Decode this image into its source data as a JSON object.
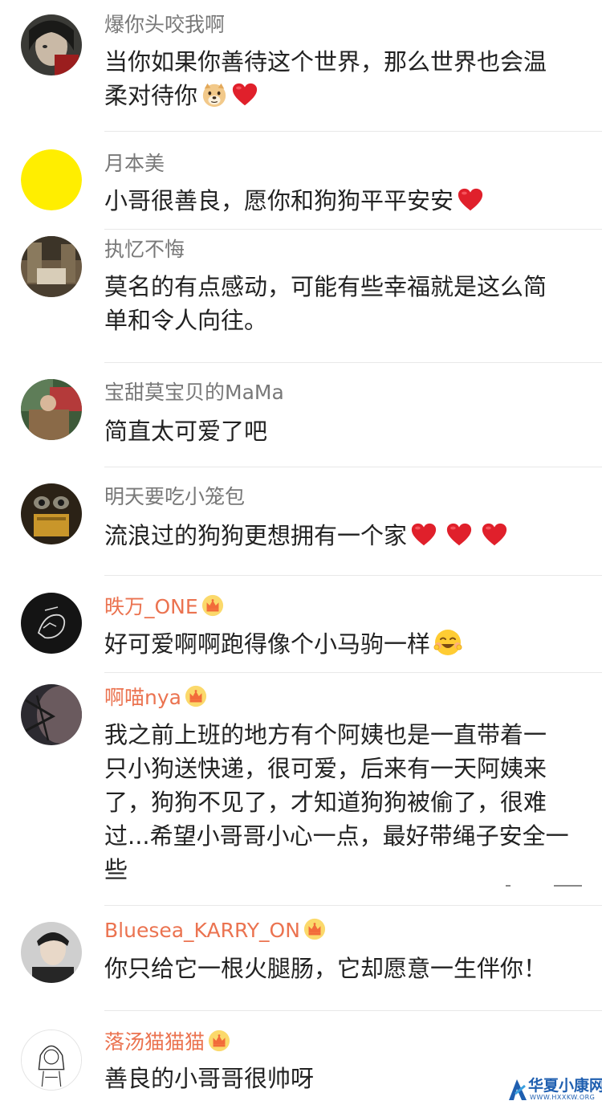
{
  "comments": [
    {
      "username": "爆你头咬我啊",
      "vip": false,
      "lines": [
        "当你如果你善待这个世界，那么世界也会温",
        "柔对待你"
      ],
      "emojis": [
        "doge-emoji",
        "heart-emoji"
      ]
    },
    {
      "username": "月本美",
      "vip": false,
      "lines": [
        "小哥很善良，愿你和狗狗平平安安"
      ],
      "emojis": [
        "heart-emoji"
      ]
    },
    {
      "username": "执忆不悔",
      "vip": false,
      "lines": [
        "莫名的有点感动，可能有些幸福就是这么简",
        "单和令人向往。"
      ],
      "emojis": []
    },
    {
      "username": "宝甜莫宝贝的MaMa",
      "vip": false,
      "lines": [
        "简直太可爱了吧"
      ],
      "emojis": []
    },
    {
      "username": "明天要吃小笼包",
      "vip": false,
      "lines": [
        "流浪过的狗狗更想拥有一个家"
      ],
      "emojis": [
        "heart-emoji",
        "heart-emoji",
        "heart-emoji"
      ]
    },
    {
      "username": "昳万_ONE",
      "vip": true,
      "lines": [
        "好可爱啊啊跑得像个小马驹一样"
      ],
      "emojis": [
        "smile-emoji"
      ]
    },
    {
      "username": "啊喵nya",
      "vip": true,
      "lines": [
        "我之前上班的地方有个阿姨也是一直带着一",
        "只小狗送快递，很可爱，后来有一天阿姨来",
        "了，狗狗不见了，才知道狗狗被偷了，很难",
        "过...希望小哥哥小心一点，最好带绳子安全一",
        "些"
      ],
      "emojis": []
    },
    {
      "username": "Bluesea_KARRY_ON",
      "vip": true,
      "lines": [
        "你只给它一根火腿肠，它却愿意一生伴你！"
      ],
      "emojis": []
    },
    {
      "username": "落汤猫猫猫",
      "vip": true,
      "lines": [
        "善良的小哥哥很帅呀"
      ],
      "emojis": []
    }
  ],
  "colors": {
    "username": "#787878",
    "vip_username": "#eb7350",
    "text": "#222222",
    "divider": "#e8e8e8"
  },
  "watermark": {
    "title": "华夏小康网",
    "url": "WWW.HXXKW.ORG"
  }
}
